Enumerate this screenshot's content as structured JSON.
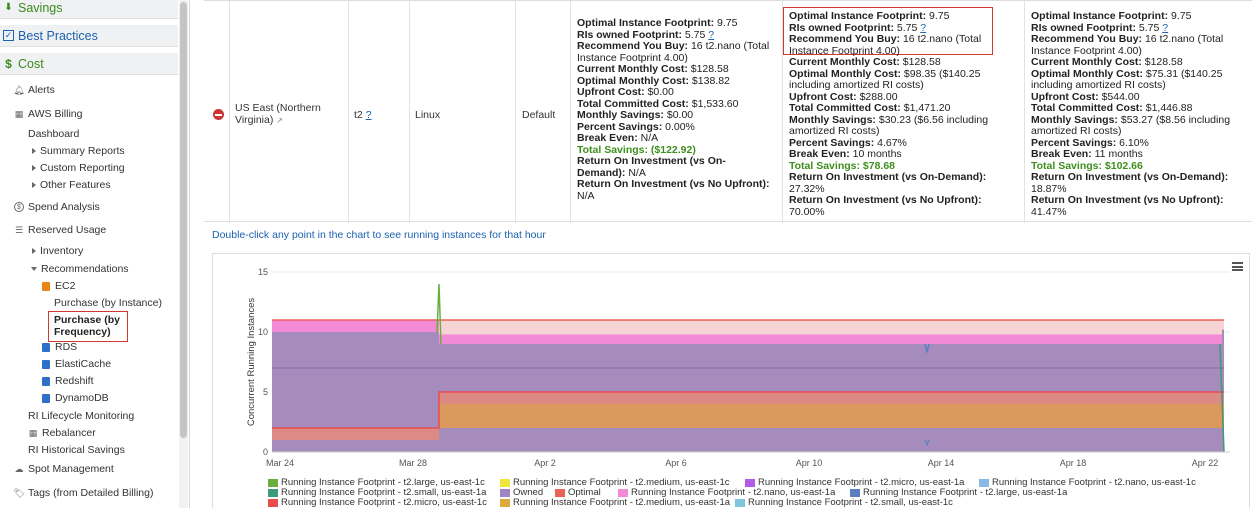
{
  "sidebar": {
    "savings": "Savings",
    "best_practices": "Best Practices",
    "cost": "Cost",
    "items": {
      "alerts": "Alerts",
      "aws_billing": "AWS Billing",
      "dashboard": "Dashboard",
      "summary_reports": "Summary Reports",
      "custom_reporting": "Custom Reporting",
      "other_features": "Other Features",
      "spend_analysis": "Spend Analysis",
      "reserved_usage": "Reserved Usage",
      "inventory": "Inventory",
      "recommendations": "Recommendations",
      "ec2": "EC2",
      "purchase_by_instance": "Purchase (by Instance)",
      "purchase_by_frequency_1": "Purchase (by",
      "purchase_by_frequency_2": "Frequency)",
      "rds": "RDS",
      "elasticache": "ElastiCache",
      "redshift": "Redshift",
      "dynamodb": "DynamoDB",
      "ri_lifecycle": "RI Lifecycle Monitoring",
      "rebalancer": "Rebalancer",
      "ri_historical": "RI Historical Savings",
      "spot_management": "Spot Management",
      "tags": "Tags (from Detailed Billing)"
    }
  },
  "row": {
    "region_1": "US East (Northern",
    "region_2": "Virginia)",
    "family": "t2",
    "help": "?",
    "platform": "Linux",
    "tenancy": "Default"
  },
  "recs": [
    {
      "optimal_footprint": "9.75",
      "ris_owned": "5.75",
      "buy_1": "16 t2.nano (Total",
      "buy_2": "Instance Footprint 4.00)",
      "current_monthly": "$128.58",
      "optimal_monthly_1": "$138.82",
      "optimal_monthly_2": "",
      "upfront": "$0.00",
      "total_committed": "$1,533.60",
      "monthly_savings_1": "$0.00",
      "monthly_savings_2": "",
      "percent": "0.00%",
      "break_even": "N/A",
      "total_savings": "($122.92)",
      "roi_ondemand_1": "Return On Investment (vs On-",
      "roi_ondemand_2": "Demand): ",
      "roi_ondemand_val": "N/A",
      "roi_noupfront": "Return On Investment (vs No Upfront):",
      "roi_noupfront_val": "N/A"
    },
    {
      "optimal_footprint": "9.75",
      "ris_owned": "5.75",
      "buy_1": "16 t2.nano (Total",
      "buy_2": "Instance Footprint 4.00)",
      "current_monthly": "$128.58",
      "optimal_monthly_1": "$98.35 ($140.25",
      "optimal_monthly_2": "including amortized RI costs)",
      "upfront": "$288.00",
      "total_committed": "$1,471.20",
      "monthly_savings_1": "$30.23 ($6.56 including",
      "monthly_savings_2": "amortized RI costs)",
      "percent": "4.67%",
      "break_even": "10 months",
      "total_savings": "$78.68",
      "roi_ondemand_1": "Return On Investment (vs On-Demand):",
      "roi_ondemand_2": "",
      "roi_ondemand_val": "27.32%",
      "roi_noupfront": "Return On Investment (vs No Upfront):",
      "roi_noupfront_val": "70.00%"
    },
    {
      "optimal_footprint": "9.75",
      "ris_owned": "5.75",
      "buy_1": "16 t2.nano (Total",
      "buy_2": "Instance Footprint 4.00)",
      "current_monthly": "$128.58",
      "optimal_monthly_1": "$75.31 ($140.25",
      "optimal_monthly_2": "including amortized RI costs)",
      "upfront": "$544.00",
      "total_committed": "$1,446.88",
      "monthly_savings_1": "$53.27 ($8.56 including",
      "monthly_savings_2": "amortized RI costs)",
      "percent": "6.10%",
      "break_even": "11 months",
      "total_savings": "$102.66",
      "roi_ondemand_1": "Return On Investment (vs On-Demand):",
      "roi_ondemand_2": "",
      "roi_ondemand_val": "18.87%",
      "roi_noupfront": "Return On Investment (vs No Upfront):",
      "roi_noupfront_val": "41.47%"
    }
  ],
  "labels": {
    "optimal_footprint": "Optimal Instance Footprint:",
    "ris_owned": "RIs owned Footprint:",
    "recommend": "Recommend You Buy:",
    "current_monthly": "Current Monthly Cost:",
    "optimal_monthly": "Optimal Monthly Cost:",
    "upfront": "Upfront Cost:",
    "total_committed": "Total Committed Cost:",
    "monthly_savings": "Monthly Savings:",
    "percent": "Percent Savings:",
    "break_even": "Break Even:",
    "total_savings": "Total Savings:"
  },
  "hint": "Double-click any point in the chart to see running instances for that hour",
  "chart_data": {
    "type": "area",
    "ylabel": "Concurrent Running Instances",
    "ylim": [
      0,
      15
    ],
    "yticks": [
      0,
      5,
      10,
      15
    ],
    "xticks": [
      "Mar 24",
      "Mar 28",
      "Apr 2",
      "Apr 6",
      "Apr 10",
      "Apr 14",
      "Apr 18",
      "Apr 22"
    ],
    "series": [
      {
        "name": "Owned",
        "color": "#9f85c6",
        "x": [
          "Mar 24",
          "Mar 28",
          "Apr 22"
        ],
        "y": [
          10,
          9,
          10.2
        ]
      },
      {
        "name": "Running Instance Footprint - t2.nano, us-east-1a",
        "color": "#f28ad8",
        "x": [
          "Mar 24",
          "Mar 28",
          "Apr 22"
        ],
        "y": [
          11,
          9.8,
          9.8
        ]
      },
      {
        "name": "Running Instance Footprint - t2.micro, us-east-1c",
        "color": "#e84c4c",
        "x": [
          "Mar 24",
          "Mar 28",
          "Apr 22"
        ],
        "y": [
          2,
          5,
          5
        ]
      },
      {
        "name": "Running Instance Footprint - t2.medium, us-east-1a",
        "color": "#e0a93c",
        "x": [
          "Mar 24",
          "Mar 28",
          "Apr 22"
        ],
        "y": [
          1,
          4,
          4
        ]
      },
      {
        "name": "Running Instance Footprint - t2.large, us-east-1c",
        "color": "#6aaf3e",
        "x": [
          "Mar 28"
        ],
        "y": [
          14
        ]
      },
      {
        "name": "Optimal",
        "color": "#e8625a",
        "x": [
          "Mar 24",
          "Apr 22"
        ],
        "y": [
          11,
          11
        ]
      }
    ]
  },
  "legend": [
    {
      "label": "Running Instance Footprint - t2.large, us-east-1c",
      "color": "#6aaf3e"
    },
    {
      "label": "Running Instance Footprint - t2.medium, us-east-1c",
      "color": "#f0e53c"
    },
    {
      "label": "Running Instance Footprint - t2.micro, us-east-1a",
      "color": "#b15be8"
    },
    {
      "label": "Running Instance Footprint - t2.nano, us-east-1c",
      "color": "#8cb8e8"
    },
    {
      "label": "Running Instance Footprint - t2.small, us-east-1a",
      "color": "#3d9a7a"
    },
    {
      "label": "Owned",
      "color": "#9f85c6"
    },
    {
      "label": "Optimal",
      "color": "#e8625a"
    },
    {
      "label": "Running Instance Footprint - t2.nano, us-east-1a",
      "color": "#f28ad8"
    },
    {
      "label": "Running Instance Footprint - t2.large, us-east-1a",
      "color": "#5b7fc1"
    },
    {
      "label": "Running Instance Footprint - t2.micro, us-east-1c",
      "color": "#e84c4c"
    },
    {
      "label": "Running Instance Footprint - t2.medium, us-east-1a",
      "color": "#e0a93c"
    },
    {
      "label": "Running Instance Footprint - t2.small, us-east-1c",
      "color": "#7fc6e0"
    }
  ]
}
